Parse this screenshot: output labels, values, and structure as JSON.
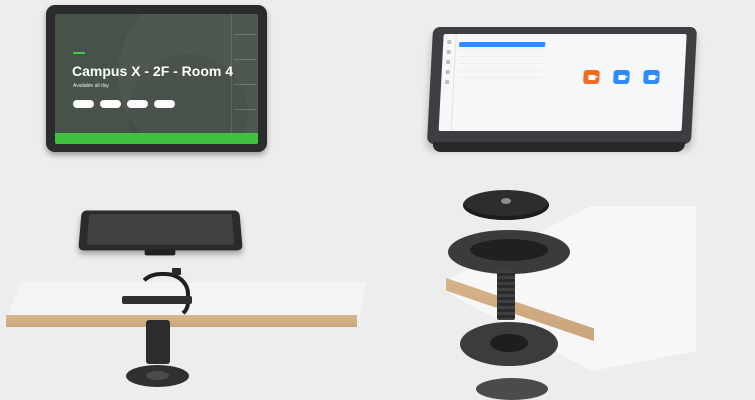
{
  "booking_panel": {
    "badge": "",
    "room_name": "Campus X - 2F - Room 4",
    "status": "Available all day",
    "time_buttons": [
      "",
      "",
      "",
      ""
    ],
    "timeline_header": "",
    "timeline_labels": [
      "",
      "",
      "",
      ""
    ],
    "bottom_actions": [
      "",
      "",
      "",
      ""
    ],
    "accent_color": "#3fc13f"
  },
  "zoom_panel": {
    "header": "",
    "header_right": "",
    "meetings": [
      {
        "title": "",
        "sub": ""
      },
      {
        "title": "",
        "sub": ""
      },
      {
        "title": "",
        "sub": ""
      },
      {
        "title": "",
        "sub": ""
      },
      {
        "title": "",
        "sub": ""
      }
    ],
    "start_label": "",
    "actions": [
      {
        "icon": "camera-icon",
        "label": "",
        "color": "#f26d21"
      },
      {
        "icon": "camera-icon",
        "label": "",
        "color": "#2d8cff"
      },
      {
        "icon": "share-screen-icon",
        "label": "",
        "color": "#2d8cff"
      }
    ]
  }
}
